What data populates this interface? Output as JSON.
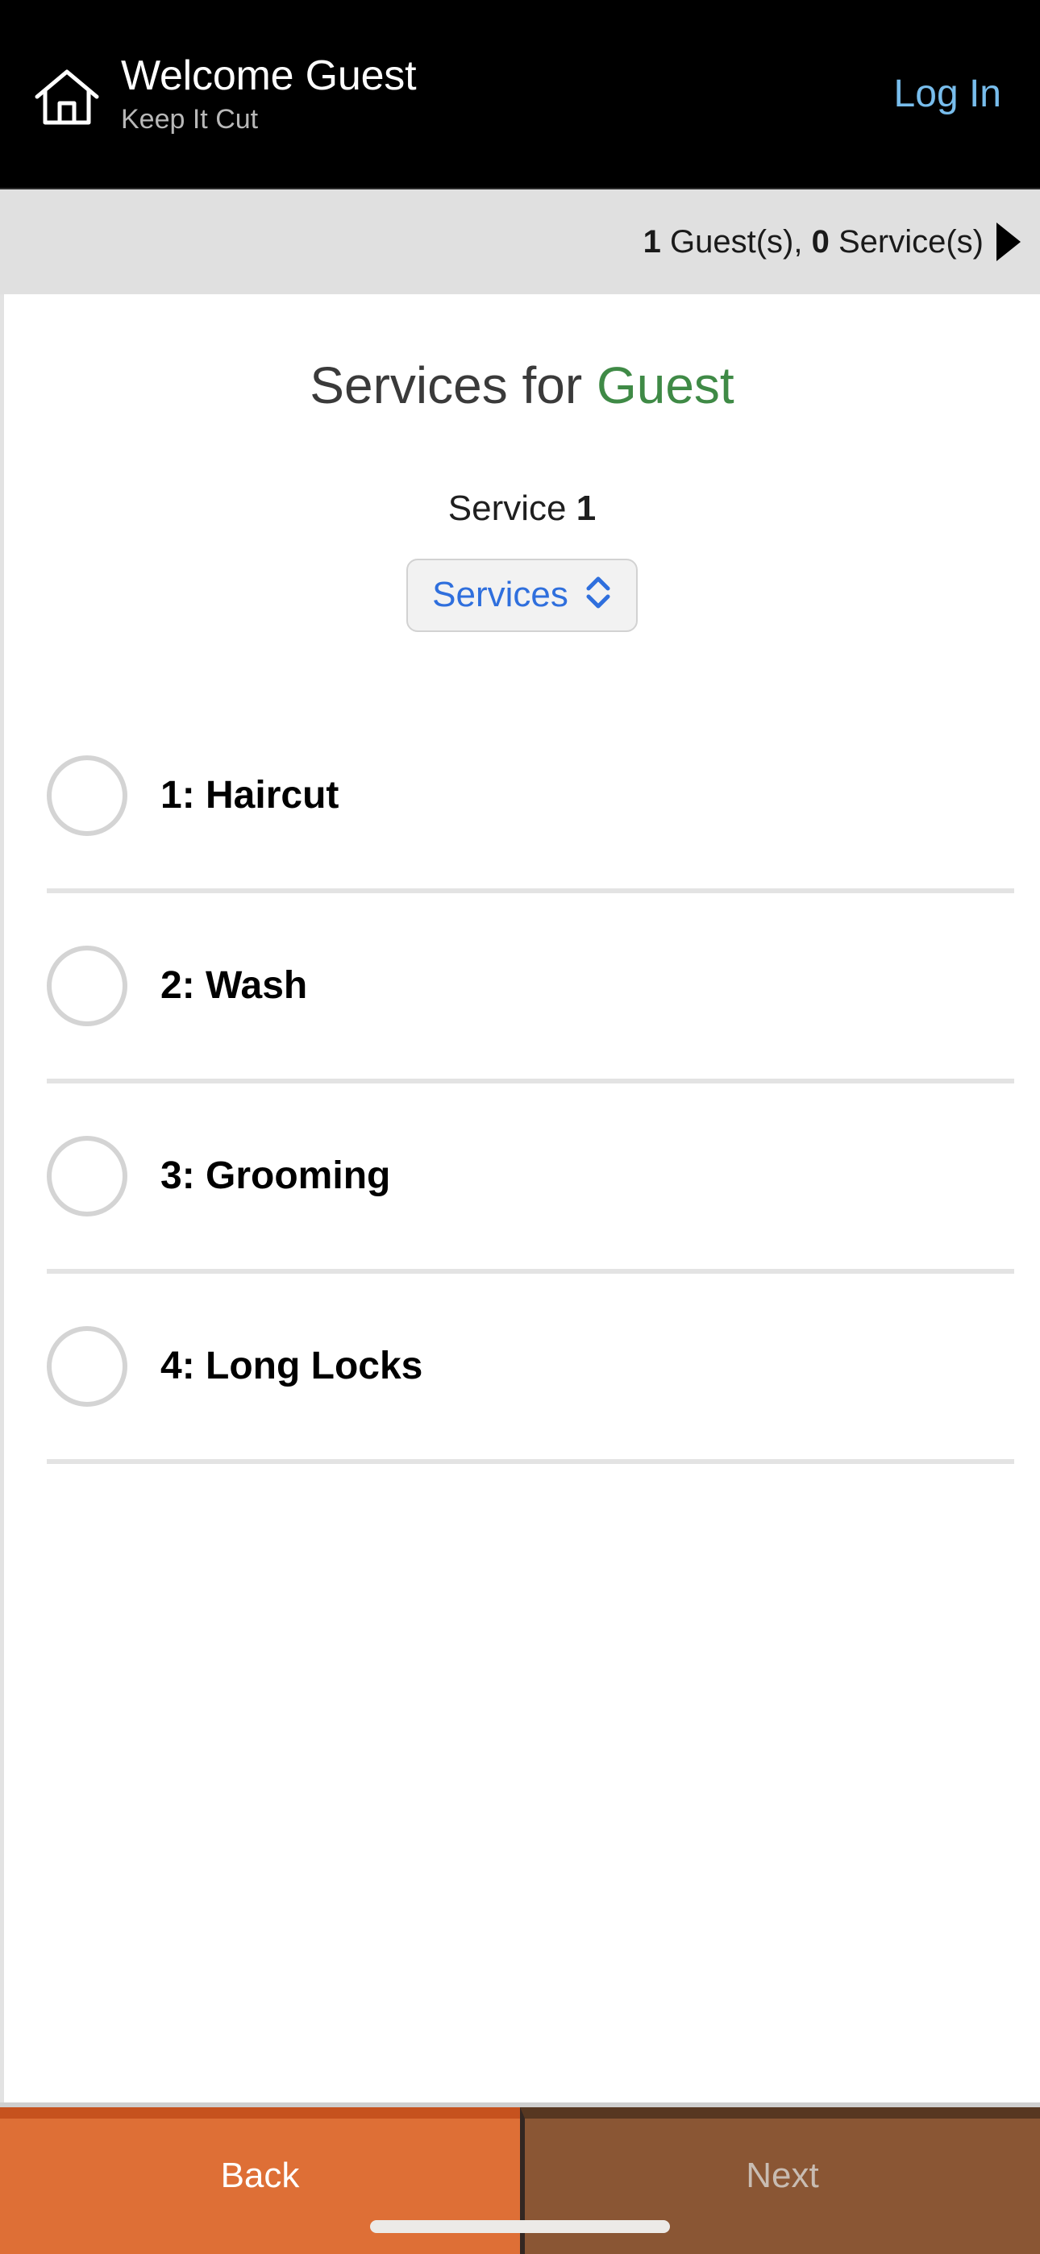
{
  "header": {
    "home_icon": "home-icon",
    "welcome_title": "Welcome Guest",
    "business_name": "Keep It Cut",
    "login_label": "Log In"
  },
  "summary_bar": {
    "guest_count": "1",
    "guest_label": " Guest(s), ",
    "service_count": "0",
    "service_label": " Service(s)",
    "caret_icon": "caret-right-icon"
  },
  "main": {
    "title_prefix": "Services for ",
    "title_accent": "Guest",
    "service_label_prefix": "Service ",
    "service_number": "1",
    "select": {
      "value": "Services",
      "icon": "chevron-up-down-icon",
      "options": [
        "Services"
      ]
    },
    "options": [
      {
        "label": "1: Haircut",
        "selected": false
      },
      {
        "label": "2: Wash",
        "selected": false
      },
      {
        "label": "3: Grooming",
        "selected": false
      },
      {
        "label": "4: Long Locks",
        "selected": false
      }
    ]
  },
  "bottom_nav": {
    "back_label": "Back",
    "next_label": "Next"
  },
  "colors": {
    "header_bg": "#000000",
    "summary_bg": "#e0e0e0",
    "accent_green": "#3f8a46",
    "link_blue": "#78bdec",
    "select_blue": "#2f6fdd",
    "back_orange": "#de6f36",
    "next_brown": "#8a5634"
  }
}
